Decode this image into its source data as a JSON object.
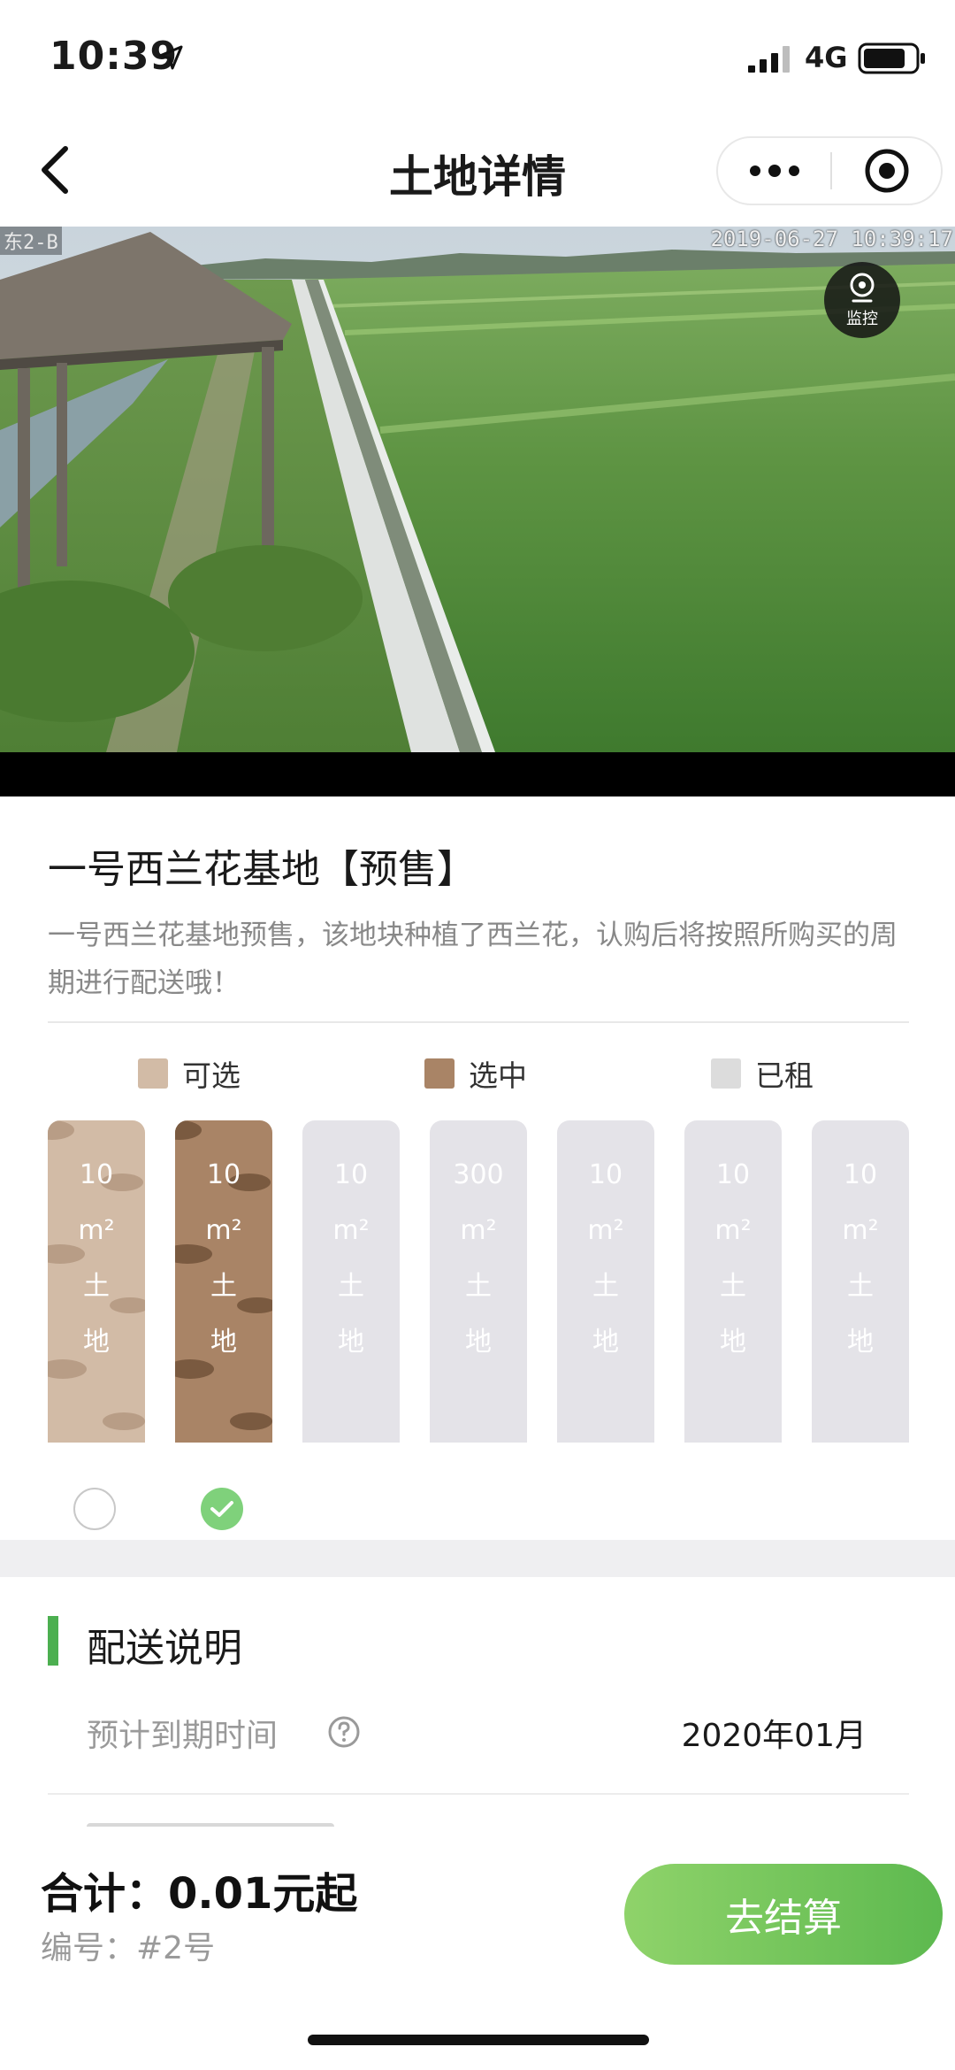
{
  "status_bar": {
    "time": "10:39",
    "network": "4G"
  },
  "nav": {
    "title": "土地详情"
  },
  "video": {
    "camera_label": "东2-B",
    "timestamp": "2019-06-27 10:39:17",
    "monitor_label": "监控"
  },
  "land": {
    "title": "一号西兰花基地【预售】",
    "description": "一号西兰花基地预售，该地块种植了西兰花，认购后将按照所购买的周期进行配送哦！"
  },
  "legend": [
    {
      "label": "可选",
      "color": "#d2bba6"
    },
    {
      "label": "选中",
      "color": "#a98466"
    },
    {
      "label": "已租",
      "color": "#dcdcdc"
    }
  ],
  "plots": [
    {
      "size": "10",
      "unit": "m²",
      "c1": "土",
      "c2": "地",
      "state": "available"
    },
    {
      "size": "10",
      "unit": "m²",
      "c1": "土",
      "c2": "地",
      "state": "selected"
    },
    {
      "size": "10",
      "unit": "m²",
      "c1": "土",
      "c2": "地",
      "state": "rented"
    },
    {
      "size": "300",
      "unit": "m²",
      "c1": "土",
      "c2": "地",
      "state": "rented"
    },
    {
      "size": "10",
      "unit": "m²",
      "c1": "土",
      "c2": "地",
      "state": "rented"
    },
    {
      "size": "10",
      "unit": "m²",
      "c1": "土",
      "c2": "地",
      "state": "rented"
    },
    {
      "size": "10",
      "unit": "m²",
      "c1": "土",
      "c2": "地",
      "state": "rented"
    }
  ],
  "delivery": {
    "section_title": "配送说明",
    "expiry_label": "预计到期时间",
    "expiry_value": "2020年01月"
  },
  "footer": {
    "total": "合计：0.01元起",
    "serial": "编号：#2号",
    "checkout_label": "去结算"
  },
  "colors": {
    "accent": "#5db94f",
    "selected_plot": "#a98466",
    "available_plot": "#d2bba6",
    "rented_plot": "#e4e3e8"
  }
}
